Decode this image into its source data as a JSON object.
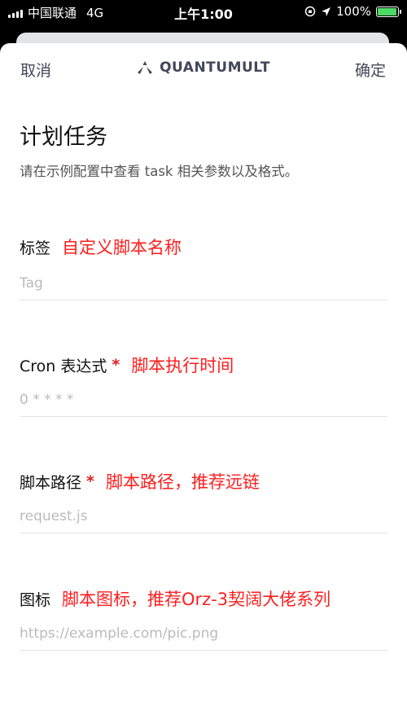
{
  "status_bar": {
    "carrier": "中国联通",
    "network": "4G",
    "time": "上午1:00",
    "battery": "100%"
  },
  "nav": {
    "cancel_label": "取消",
    "title": "QUANTUMULT",
    "confirm_label": "确定"
  },
  "page": {
    "title": "计划任务",
    "subtitle": "请在示例配置中查看 task 相关参数以及格式。"
  },
  "fields": {
    "tag": {
      "label": "标签",
      "required": false,
      "annotation": "自定义脚本名称",
      "placeholder": "Tag"
    },
    "cron": {
      "label": "Cron 表达式",
      "required": true,
      "annotation": "脚本执行时间",
      "placeholder": "0 * * * *"
    },
    "path": {
      "label": "脚本路径",
      "required": true,
      "annotation": "脚本路径，推荐远链",
      "placeholder": "request.js"
    },
    "icon": {
      "label": "图标",
      "required": false,
      "annotation": "脚本图标，推荐Orz-3契阔大佬系列",
      "placeholder": "https://example.com/pic.png"
    }
  },
  "required_mark": "*",
  "colors": {
    "annotation": "#ff1e1e",
    "required": "#e02020",
    "nav_text": "#44465a",
    "battery": "#4cd964"
  }
}
